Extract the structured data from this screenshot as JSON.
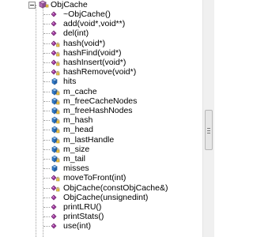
{
  "class_view": {
    "class_name": "ObjCache",
    "members": [
      {
        "label": "~ObjCache()",
        "icon": "method-icon",
        "color": "#a03ca0",
        "access": "public"
      },
      {
        "label": "add(void*,void**)",
        "icon": "method-icon",
        "color": "#a03ca0",
        "access": "public"
      },
      {
        "label": "del(int)",
        "icon": "method-icon",
        "color": "#a03ca0",
        "access": "public"
      },
      {
        "label": "hash(void*)",
        "icon": "method-icon",
        "color": "#a03ca0",
        "access": "private"
      },
      {
        "label": "hashFind(void*)",
        "icon": "method-icon",
        "color": "#a03ca0",
        "access": "private"
      },
      {
        "label": "hashInsert(void*)",
        "icon": "method-icon",
        "color": "#a03ca0",
        "access": "private"
      },
      {
        "label": "hashRemove(void*)",
        "icon": "method-icon",
        "color": "#a03ca0",
        "access": "private"
      },
      {
        "label": "hits",
        "icon": "field-icon",
        "color": "#2d7fd6",
        "access": "public"
      },
      {
        "label": "m_cache",
        "icon": "field-icon",
        "color": "#2d7fd6",
        "access": "private"
      },
      {
        "label": "m_freeCacheNodes",
        "icon": "field-icon",
        "color": "#2d7fd6",
        "access": "private"
      },
      {
        "label": "m_freeHashNodes",
        "icon": "field-icon",
        "color": "#2d7fd6",
        "access": "private"
      },
      {
        "label": "m_hash",
        "icon": "field-icon",
        "color": "#2d7fd6",
        "access": "private"
      },
      {
        "label": "m_head",
        "icon": "field-icon",
        "color": "#2d7fd6",
        "access": "private"
      },
      {
        "label": "m_lastHandle",
        "icon": "field-icon",
        "color": "#2d7fd6",
        "access": "private"
      },
      {
        "label": "m_size",
        "icon": "field-icon",
        "color": "#2d7fd6",
        "access": "private"
      },
      {
        "label": "m_tail",
        "icon": "field-icon",
        "color": "#2d7fd6",
        "access": "private"
      },
      {
        "label": "misses",
        "icon": "field-icon",
        "color": "#2d7fd6",
        "access": "public"
      },
      {
        "label": "moveToFront(int)",
        "icon": "method-icon",
        "color": "#a03ca0",
        "access": "private"
      },
      {
        "label": "ObjCache(constObjCache&)",
        "icon": "method-icon",
        "color": "#a03ca0",
        "access": "private"
      },
      {
        "label": "ObjCache(unsignedint)",
        "icon": "method-icon",
        "color": "#a03ca0",
        "access": "public"
      },
      {
        "label": "printLRU()",
        "icon": "method-icon",
        "color": "#a03ca0",
        "access": "public"
      },
      {
        "label": "printStats()",
        "icon": "method-icon",
        "color": "#a03ca0",
        "access": "public"
      },
      {
        "label": "use(int)",
        "icon": "method-icon",
        "color": "#a03ca0",
        "access": "public"
      }
    ]
  },
  "scroll": {
    "position_fraction": 0.56,
    "visible_fraction": 0.17
  }
}
